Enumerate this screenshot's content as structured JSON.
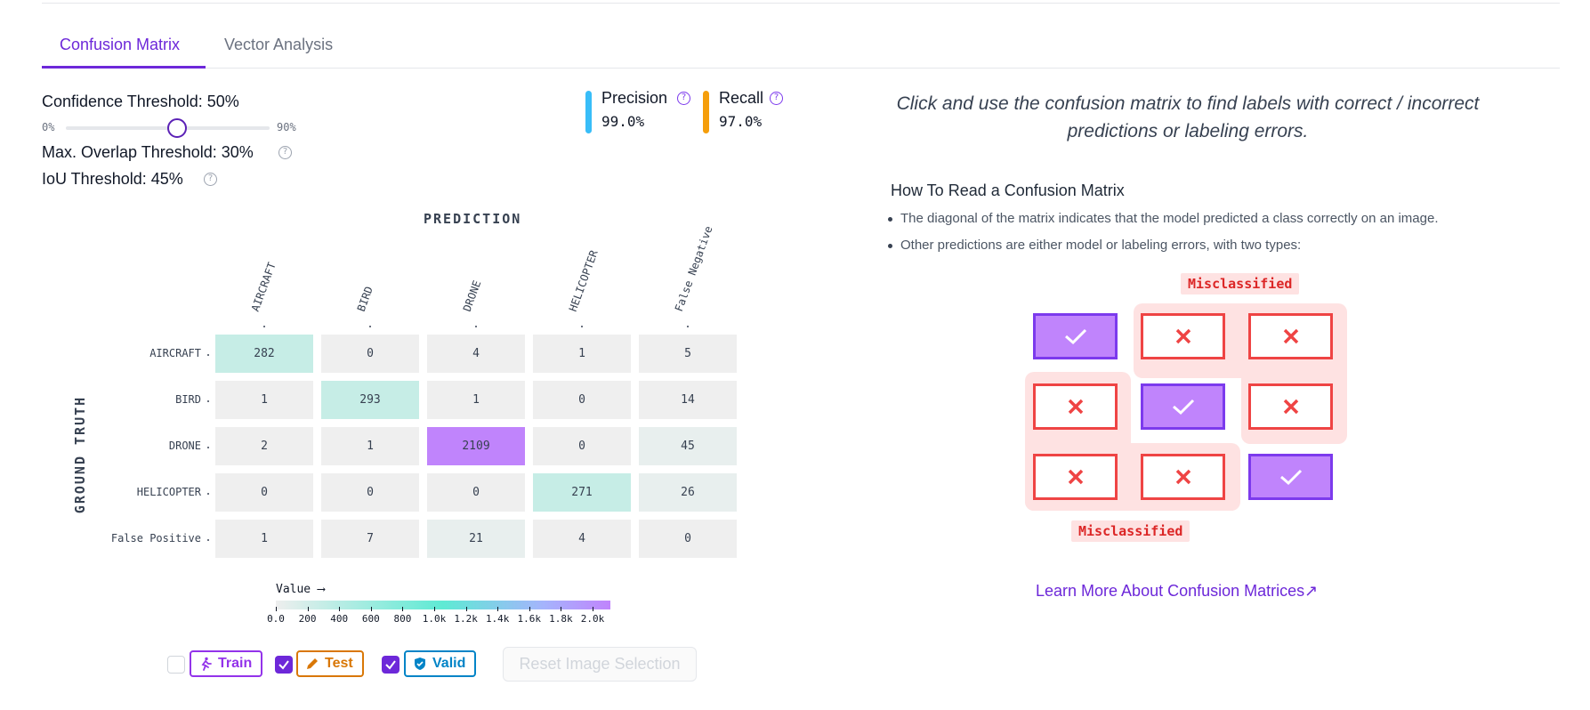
{
  "tabs": [
    {
      "label": "Confusion Matrix",
      "active": true
    },
    {
      "label": "Vector Analysis",
      "active": false
    }
  ],
  "thresholds": {
    "confidence_label": "Confidence Threshold: 50%",
    "confidence_value": 0.5,
    "slider_min": "0%",
    "slider_max": "90%",
    "overlap_label": "Max. Overlap Threshold: 30%",
    "iou_label": "IoU Threshold: 45%",
    "help_glyph": "?"
  },
  "metrics": {
    "precision_label": "Precision",
    "precision_value": "99.0%",
    "precision_color": "#38bdf8",
    "recall_label": "Recall",
    "recall_value": "97.0%",
    "recall_color": "#f59e0b"
  },
  "matrix": {
    "x_axis_title": "PREDICTION",
    "y_axis_title": "GROUND TRUTH",
    "columns": [
      "AIRCRAFT",
      "BIRD",
      "DRONE",
      "HELICOPTER",
      "False Negative"
    ],
    "rows": [
      "AIRCRAFT",
      "BIRD",
      "DRONE",
      "HELICOPTER",
      "False Positive"
    ],
    "values": [
      [
        282,
        0,
        4,
        1,
        5
      ],
      [
        1,
        293,
        1,
        0,
        14
      ],
      [
        2,
        1,
        2109,
        0,
        45
      ],
      [
        0,
        0,
        0,
        271,
        26
      ],
      [
        1,
        7,
        21,
        4,
        0
      ]
    ]
  },
  "legend": {
    "title": "Value ⟶",
    "ticks": [
      "0.0",
      "200",
      "400",
      "600",
      "800",
      "1.0k",
      "1.2k",
      "1.4k",
      "1.6k",
      "1.8k",
      "2.0k"
    ],
    "min": 0,
    "max": 2100
  },
  "splits": [
    {
      "label": "Train",
      "checked": false,
      "color": "#9333ea",
      "icon": "runner-icon"
    },
    {
      "label": "Test",
      "checked": true,
      "color": "#d97706",
      "icon": "pencil-icon"
    },
    {
      "label": "Valid",
      "checked": true,
      "color": "#0284c7",
      "icon": "shield-check-icon"
    }
  ],
  "reset_button": "Reset Image Selection",
  "right_panel": {
    "instruction": "Click and use the confusion matrix to find labels with correct / incorrect predictions or labeling errors.",
    "howto_title": "How To Read a Confusion Matrix",
    "bullets": [
      "The diagonal of the matrix indicates that the model predicted a class correctly on an image.",
      "Other predictions are either model or labeling errors, with two types:"
    ],
    "misclassified_label": "Misclassified",
    "learn_more": "Learn More About Confusion Matrices↗"
  }
}
